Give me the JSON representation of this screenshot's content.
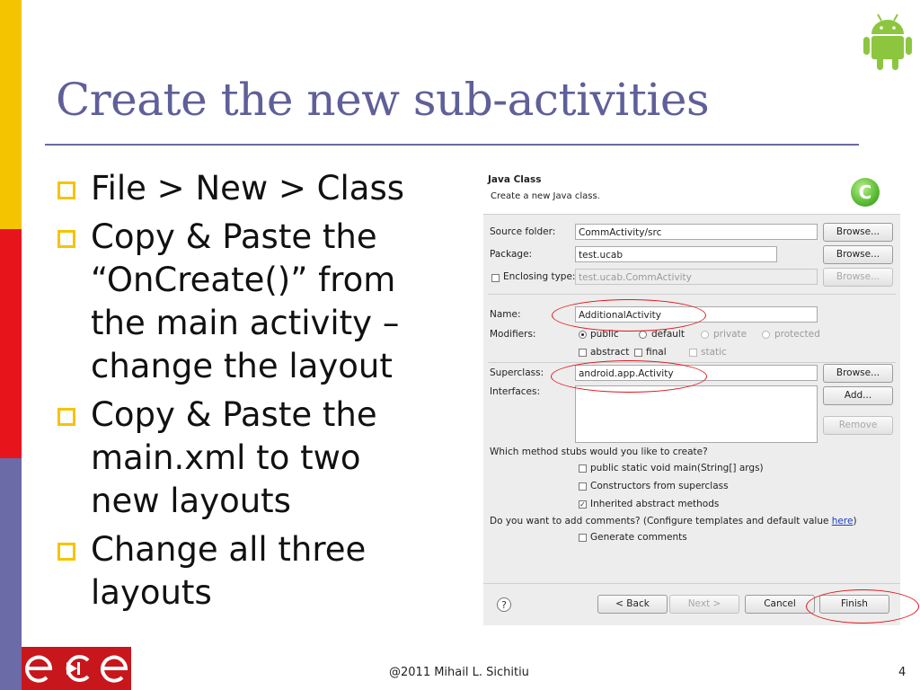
{
  "slide": {
    "title": "Create the new sub-activities",
    "bullets": [
      "File > New > Class",
      "Copy & Paste the\n“OnCreate()” from\nthe main activity –\nchange the layout",
      "Copy & Paste the\nmain.xml to two\nnew layouts",
      "Change all three\nlayouts"
    ],
    "footer": "@2011 Mihail L. Sichitiu",
    "page_number": "4",
    "icons": [
      "android-logo-icon",
      "ece-logo-icon"
    ],
    "colors": {
      "title": "#5f5f99",
      "strip_yellow": "#f5c400",
      "strip_red": "#e8141c",
      "strip_purple": "#6b6ba8",
      "highlight_red": "#e0141c"
    }
  },
  "dialog": {
    "title": "Java Class",
    "subtitle": "Create a new Java class.",
    "source_folder": {
      "label": "Source folder:",
      "value": "CommActivity/src",
      "button": "Browse..."
    },
    "package": {
      "label": "Package:",
      "value": "test.ucab",
      "button": "Browse..."
    },
    "enclosing_type": {
      "label": "Enclosing type:",
      "value": "test.ucab.CommActivity",
      "button": "Browse..."
    },
    "name": {
      "label": "Name:",
      "value": "AdditionalActivity"
    },
    "modifiers": {
      "label": "Modifiers:",
      "public": "public",
      "default": "default",
      "private": "private",
      "protected": "protected",
      "abstract": "abstract",
      "final": "final",
      "static": "static"
    },
    "superclass": {
      "label": "Superclass:",
      "value": "android.app.Activity",
      "button": "Browse..."
    },
    "interfaces": {
      "label": "Interfaces:",
      "add": "Add...",
      "remove": "Remove"
    },
    "stubs": {
      "question": "Which method stubs would you like to create?",
      "main": "public static void main(String[] args)",
      "constructors": "Constructors from superclass",
      "inherited": "Inherited abstract methods"
    },
    "comments": {
      "question_prefix": "Do you want to add comments? (Configure templates and default value ",
      "link": "here",
      "question_suffix": ")",
      "generate": "Generate comments"
    },
    "buttons": {
      "help": "?",
      "back": "< Back",
      "next": "Next >",
      "cancel": "Cancel",
      "finish": "Finish"
    }
  }
}
